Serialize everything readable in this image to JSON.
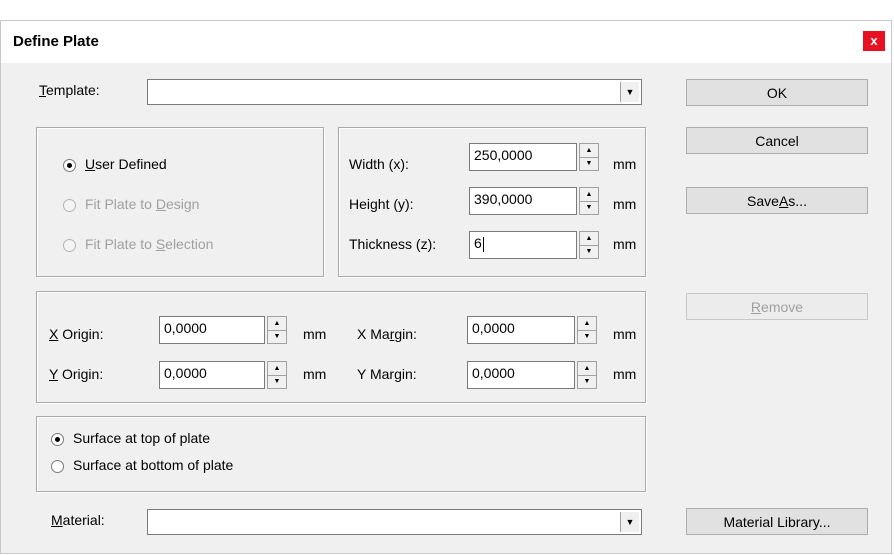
{
  "window": {
    "title": "Define Plate",
    "close_label": "x"
  },
  "template": {
    "label_u": "T",
    "label_rest": "emplate:",
    "value": ""
  },
  "buttons": {
    "ok": "OK",
    "cancel": "Cancel",
    "save_as_pre": "Save ",
    "save_as_u": "A",
    "save_as_post": "s...",
    "remove_u": "R",
    "remove_rest": "emove",
    "material_library": "Material Library..."
  },
  "mode": {
    "user_defined_u": "U",
    "user_defined_rest": "ser Defined",
    "fit_design_pre": "Fit Plate to ",
    "fit_design_u": "D",
    "fit_design_post": "esign",
    "fit_selection_pre": "Fit Plate to ",
    "fit_selection_u": "S",
    "fit_selection_post": "election",
    "selected": "user_defined"
  },
  "dimensions": {
    "width_label": "Width (x):",
    "width_value": "250,0000",
    "height_label": "Height (y):",
    "height_value": "390,0000",
    "thickness_label": "Thickness (z):",
    "thickness_value": "6",
    "unit": "mm"
  },
  "origins": {
    "x_origin_u": "X",
    "x_origin_rest": " Origin:",
    "x_origin_value": "0,0000",
    "y_origin_u": "Y",
    "y_origin_rest": " Origin:",
    "y_origin_value": "0,0000",
    "x_margin_pre": "X Ma",
    "x_margin_u": "r",
    "x_margin_post": "gin:",
    "x_margin_value": "0,0000",
    "y_margin_label": "Y Margin:",
    "y_margin_value": "0,0000",
    "unit": "mm"
  },
  "surface": {
    "top": "Surface at top of plate",
    "bottom": "Surface at bottom of plate",
    "selected": "top"
  },
  "material": {
    "label_u": "M",
    "label_rest": "aterial:",
    "value": ""
  },
  "icons": {
    "dropdown": "▼",
    "spin_up": "▲",
    "spin_down": "▼"
  }
}
